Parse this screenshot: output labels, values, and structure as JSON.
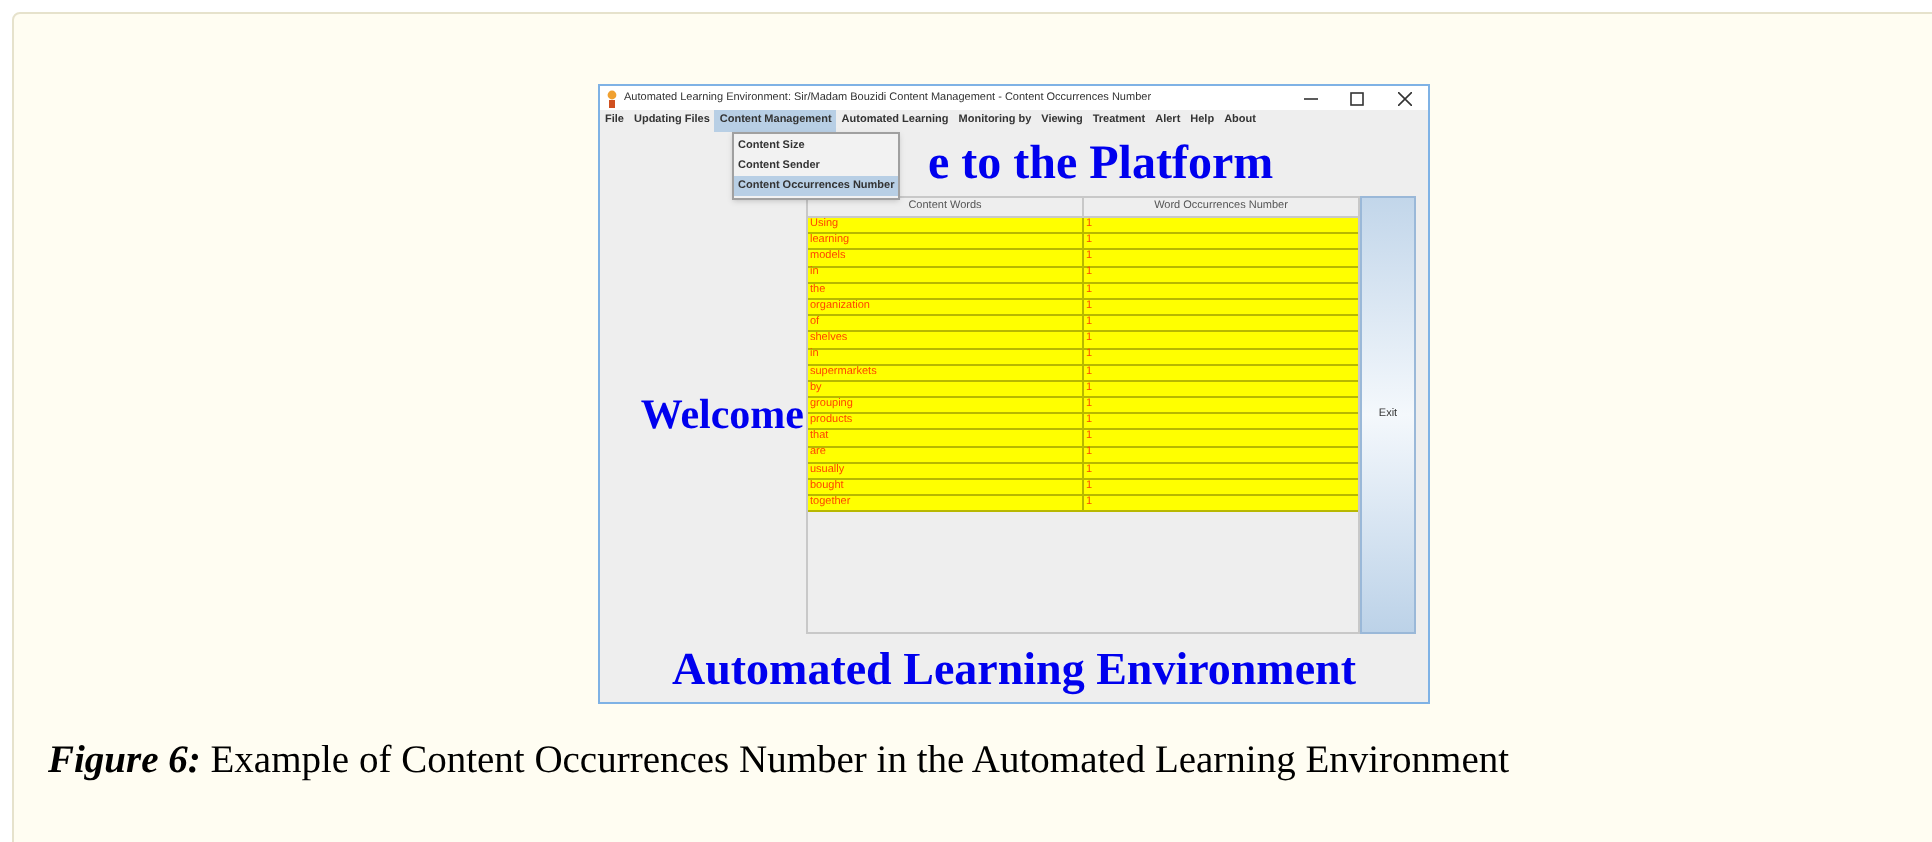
{
  "window": {
    "title": "Automated Learning Environment:  Sir/Madam  Bouzidi  Content Management - Content Occurrences Number"
  },
  "menu_bar": [
    {
      "label": "File",
      "selected": false
    },
    {
      "label": "Updating Files",
      "selected": false
    },
    {
      "label": "Content Management",
      "selected": true
    },
    {
      "label": "Automated Learning",
      "selected": false
    },
    {
      "label": "Monitoring by",
      "selected": false
    },
    {
      "label": "Viewing",
      "selected": false
    },
    {
      "label": "Treatment",
      "selected": false
    },
    {
      "label": "Alert",
      "selected": false
    },
    {
      "label": "Help",
      "selected": false
    },
    {
      "label": "About",
      "selected": false
    }
  ],
  "dropdown": [
    {
      "label": "Content Size",
      "selected": false
    },
    {
      "label": "Content Sender",
      "selected": false
    },
    {
      "label": "Content Occurrences Number",
      "selected": true
    }
  ],
  "heading": "e to the Platform",
  "welcome": "Welcome",
  "table": {
    "columns": [
      "Content Words",
      "Word Occurrences Number"
    ],
    "rows": [
      [
        "Using",
        "1"
      ],
      [
        "learning",
        "1"
      ],
      [
        "models",
        "1"
      ],
      [
        "in",
        "1"
      ],
      [
        "the",
        "1"
      ],
      [
        "organization",
        "1"
      ],
      [
        "of",
        "1"
      ],
      [
        "shelves",
        "1"
      ],
      [
        "in",
        "1"
      ],
      [
        "supermarkets",
        "1"
      ],
      [
        "by",
        "1"
      ],
      [
        "grouping",
        "1"
      ],
      [
        "products",
        "1"
      ],
      [
        "that",
        "1"
      ],
      [
        "are",
        "1"
      ],
      [
        "usually",
        "1"
      ],
      [
        "bought",
        "1"
      ],
      [
        "together",
        "1"
      ]
    ]
  },
  "exit_button": "Exit",
  "footer_title": "Automated Learning Environment",
  "caption": {
    "label": "Figure 6:",
    "text": "Example of Content Occurrences Number in the Automated Learning Environment"
  }
}
